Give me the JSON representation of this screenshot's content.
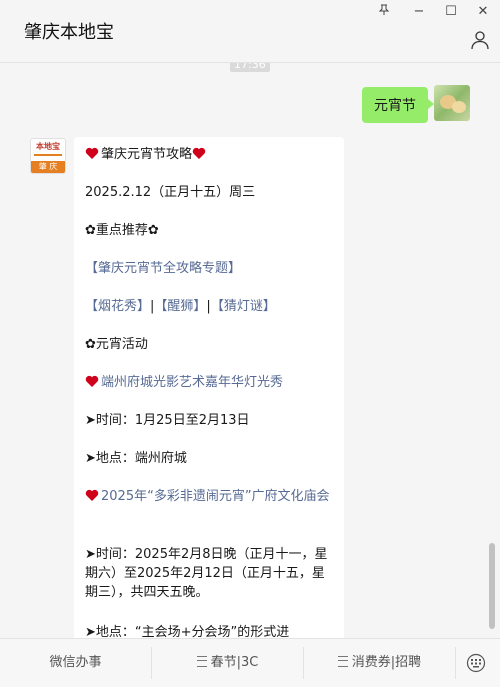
{
  "window": {
    "title": "肇庆本地宝",
    "controls": {
      "pin_icon": "pin-icon",
      "minimize": "−",
      "maximize": "☐",
      "close": "✕"
    }
  },
  "chat": {
    "timestamp": "17:36",
    "sent_message": "元宵节",
    "account_avatar": {
      "top_text": "本地宝",
      "bottom_text": "肇 庆"
    },
    "article": {
      "title": "肇庆元宵节攻略",
      "date": "2025.2.12（正月十五）周三",
      "section_recommend": "✿重点推荐✿",
      "link_topic": "【肇庆元宵节全攻略专题】",
      "link_fireworks": "【烟花秀】",
      "link_lion": "【醒狮】",
      "link_riddles": "【猜灯谜】",
      "divider": "|",
      "section_activities": "✿元宵活动",
      "event1_title": "端州府城光影艺术嘉年华灯光秀",
      "event1_time": "➤时间：1月25日至2月13日",
      "event1_place": "➤地点：端州府城",
      "event2_title": "2025年“多彩非遗闹元宵”广府文化庙会",
      "event2_time": "➤时间：2025年2月8日晚（正月十一，星期六）至2025年2月12日（正月十五，星期三），共四天五晚。",
      "event2_place": "➤地点：“主会场+分会场”的形式进"
    }
  },
  "bottom_menu": {
    "items": [
      "微信办事",
      "春节|3C",
      "消费券|招聘"
    ],
    "keyboard_icon": "keyboard-icon"
  },
  "colors": {
    "bubble_green": "#95ec69",
    "link_blue": "#576b95",
    "heart_red": "#d0021b",
    "brand_orange": "#e67e22"
  }
}
